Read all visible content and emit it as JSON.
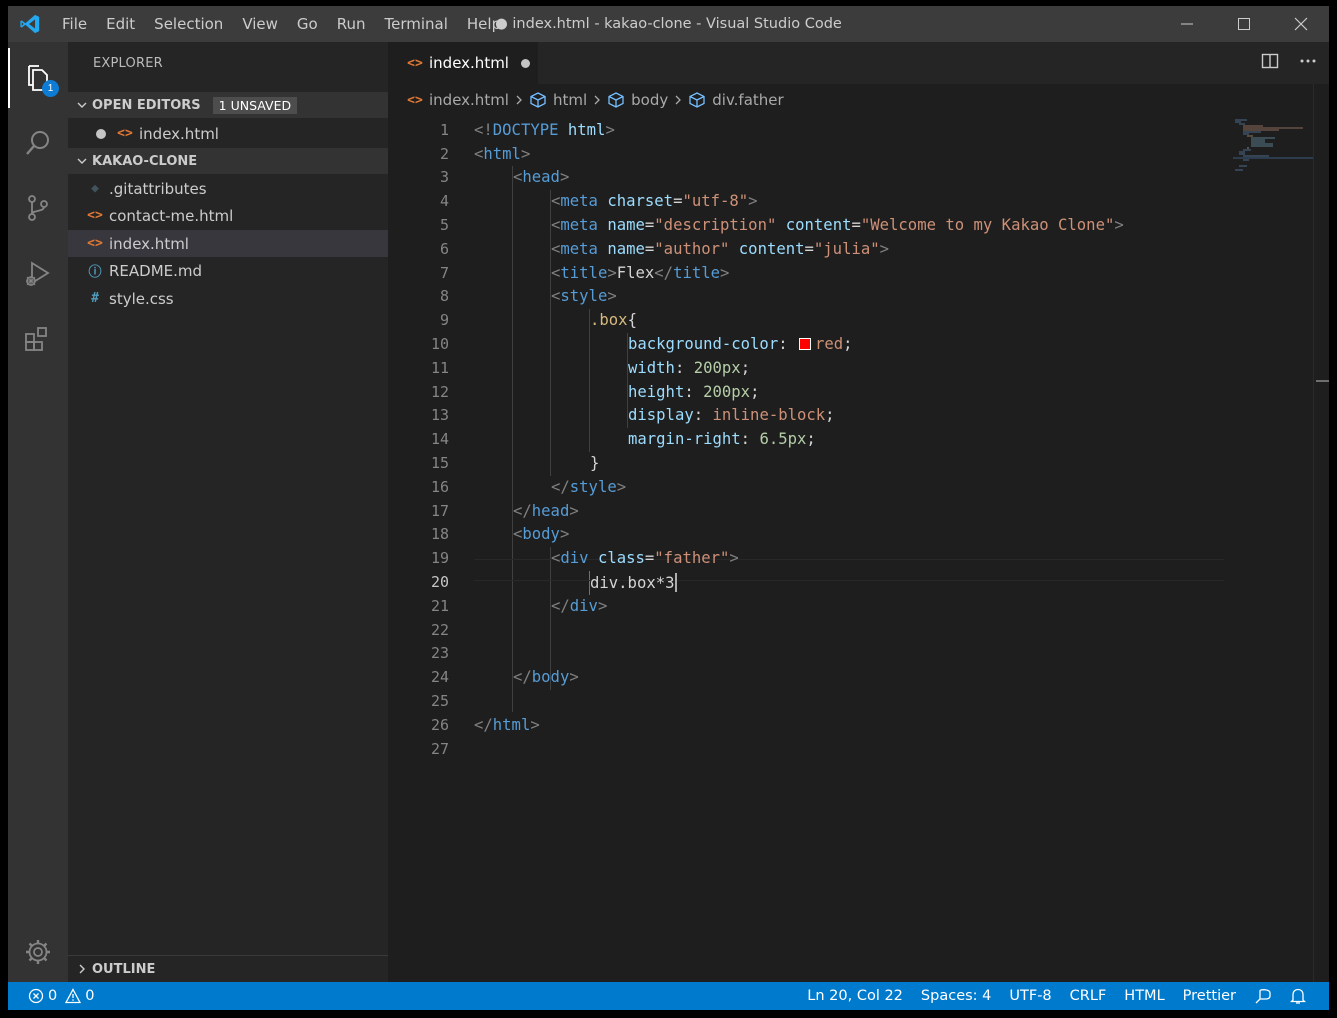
{
  "window": {
    "title": "● index.html - kakao-clone - Visual Studio Code",
    "menu": [
      "File",
      "Edit",
      "Selection",
      "View",
      "Go",
      "Run",
      "Terminal",
      "Help"
    ]
  },
  "activity": {
    "explorer_badge": "1"
  },
  "sidebar": {
    "title": "EXPLORER",
    "open_editors": {
      "label": "OPEN EDITORS",
      "badge": "1 UNSAVED",
      "items": [
        "index.html"
      ]
    },
    "folder": {
      "label": "KAKAO-CLONE",
      "files": [
        ".gitattributes",
        "contact-me.html",
        "index.html",
        "README.md",
        "style.css"
      ]
    },
    "outline_label": "OUTLINE"
  },
  "editor": {
    "tab_label": "index.html",
    "breadcrumbs": [
      "index.html",
      "html",
      "body",
      "div.father"
    ],
    "line_numbers": [
      "1",
      "2",
      "3",
      "4",
      "5",
      "6",
      "7",
      "8",
      "9",
      "10",
      "11",
      "12",
      "13",
      "14",
      "15",
      "16",
      "17",
      "18",
      "19",
      "20",
      "21",
      "22",
      "23",
      "24",
      "25",
      "26",
      "27"
    ],
    "code": {
      "l1": [
        "<!",
        "DOCTYPE",
        " html",
        ">"
      ],
      "l2": [
        "<",
        "html",
        ">"
      ],
      "l3": [
        "<",
        "head",
        ">"
      ],
      "l4": [
        "<",
        "meta",
        " ",
        "charset",
        "=",
        "\"utf-8\"",
        ">"
      ],
      "l5": [
        "<",
        "meta",
        " ",
        "name",
        "=",
        "\"description\"",
        " ",
        "content",
        "=",
        "\"Welcome to my Kakao Clone\"",
        ">"
      ],
      "l6": [
        "<",
        "meta",
        " ",
        "name",
        "=",
        "\"author\"",
        " ",
        "content",
        "=",
        "\"julia\"",
        ">"
      ],
      "l7": [
        "<",
        "title",
        ">",
        "Flex",
        "</",
        "title",
        ">"
      ],
      "l8": [
        "<",
        "style",
        ">"
      ],
      "l9": [
        ".box",
        "{"
      ],
      "l10": [
        "background-color",
        ": ",
        "red",
        ";"
      ],
      "l11": [
        "width",
        ": ",
        "200px",
        ";"
      ],
      "l12": [
        "height",
        ": ",
        "200px",
        ";"
      ],
      "l13": [
        "display",
        ": ",
        "inline-block",
        ";"
      ],
      "l14": [
        "margin-right",
        ": ",
        "6.5px",
        ";"
      ],
      "l15": [
        "}"
      ],
      "l16": [
        "</",
        "style",
        ">"
      ],
      "l17": [
        "</",
        "head",
        ">"
      ],
      "l18": [
        "<",
        "body",
        ">"
      ],
      "l19": [
        "<",
        "div",
        " ",
        "class",
        "=",
        "\"father\"",
        ">"
      ],
      "l20": [
        "div.box*3"
      ],
      "l21": [
        "</",
        "div",
        ">"
      ],
      "l24": [
        "</",
        "body",
        ">"
      ],
      "l26": [
        "</",
        "html",
        ">"
      ]
    }
  },
  "status": {
    "errors": "0",
    "warnings": "0",
    "items": [
      "Ln 20, Col 22",
      "Spaces: 4",
      "UTF-8",
      "CRLF",
      "HTML",
      "Prettier"
    ]
  },
  "colors": {
    "accent": "#007acc",
    "tag": "#569cd6",
    "attr": "#9cdcfe",
    "string": "#ce9178",
    "number": "#b5cea8",
    "selector": "#d7ba7d"
  }
}
